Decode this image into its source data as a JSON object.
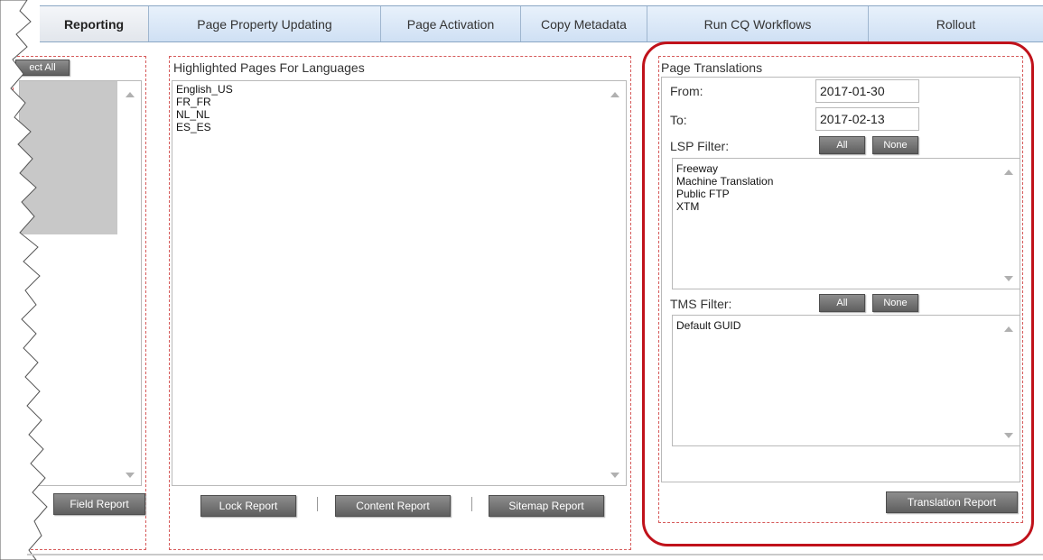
{
  "tabs": [
    {
      "label": "Reporting",
      "active": true
    },
    {
      "label": "Page Property Updating",
      "active": false
    },
    {
      "label": "Page Activation",
      "active": false
    },
    {
      "label": "Copy Metadata",
      "active": false
    },
    {
      "label": "Run CQ Workflows",
      "active": false
    },
    {
      "label": "Rollout",
      "active": false
    }
  ],
  "left_panel": {
    "select_all_label": "ect All",
    "field_report_label": "Field Report"
  },
  "languages_panel": {
    "title": "Highlighted Pages For Languages",
    "items": [
      "English_US",
      "FR_FR",
      "NL_NL",
      "ES_ES"
    ],
    "buttons": [
      "Lock Report",
      "Content Report",
      "Sitemap Report"
    ]
  },
  "translations_panel": {
    "title": "Page Translations",
    "from_label": "From:",
    "from_value": "2017-01-30",
    "to_label": "To:",
    "to_value": "2017-02-13",
    "lsp_filter_label": "LSP Filter:",
    "lsp_items": [
      "Freeway",
      "Machine Translation",
      "Public FTP",
      "XTM"
    ],
    "tms_filter_label": "TMS Filter:",
    "tms_items": [
      "Default GUID"
    ],
    "all_label": "All",
    "none_label": "None",
    "report_button": "Translation Report"
  },
  "colors": {
    "highlight": "#c0121b",
    "panel_border": "#d65a5a",
    "button": "#6e6e6e",
    "tab_bg": "#dce9f8"
  }
}
